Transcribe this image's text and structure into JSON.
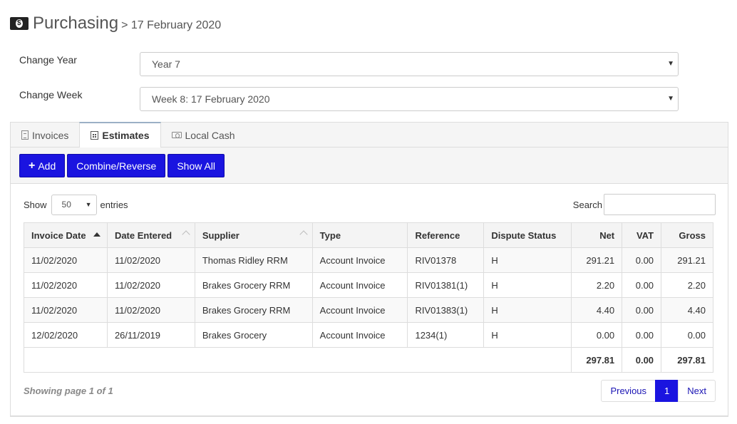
{
  "header": {
    "title": "Purchasing",
    "subtitle": "> 17 February 2020"
  },
  "filters": {
    "year_label": "Change Year",
    "year_value": "Year 7",
    "week_label": "Change Week",
    "week_value": "Week 8: 17 February 2020"
  },
  "tabs": [
    {
      "label": "Invoices",
      "active": false
    },
    {
      "label": "Estimates",
      "active": true
    },
    {
      "label": "Local Cash",
      "active": false
    }
  ],
  "toolbar": {
    "add_label": "Add",
    "combine_label": "Combine/Reverse",
    "show_all_label": "Show All"
  },
  "table_controls": {
    "show_label": "Show",
    "entries_value": "50",
    "entries_label": "entries",
    "search_label": "Search"
  },
  "table": {
    "columns": [
      "Invoice Date",
      "Date Entered",
      "Supplier",
      "Type",
      "Reference",
      "Dispute Status",
      "Net",
      "VAT",
      "Gross"
    ],
    "rows": [
      [
        "11/02/2020",
        "11/02/2020",
        "Thomas Ridley RRM",
        "Account Invoice",
        "RIV01378",
        "H",
        "291.21",
        "0.00",
        "291.21"
      ],
      [
        "11/02/2020",
        "11/02/2020",
        "Brakes Grocery RRM",
        "Account Invoice",
        "RIV01381(1)",
        "H",
        "2.20",
        "0.00",
        "2.20"
      ],
      [
        "11/02/2020",
        "11/02/2020",
        "Brakes Grocery RRM",
        "Account Invoice",
        "RIV01383(1)",
        "H",
        "4.40",
        "0.00",
        "4.40"
      ],
      [
        "12/02/2020",
        "26/11/2019",
        "Brakes Grocery",
        "Account Invoice",
        "1234(1)",
        "H",
        "0.00",
        "0.00",
        "0.00"
      ]
    ],
    "totals": {
      "net": "297.81",
      "vat": "0.00",
      "gross": "297.81"
    }
  },
  "footer": {
    "info": "Showing page 1 of 1",
    "previous": "Previous",
    "page": "1",
    "next": "Next"
  },
  "colors": {
    "primary": "#1a14e0",
    "link": "#1a14b4"
  },
  "icons": {
    "header": "money-icon",
    "invoices": "document-icon",
    "estimates": "calculator-icon",
    "local_cash": "cash-icon",
    "add": "plus-icon"
  }
}
